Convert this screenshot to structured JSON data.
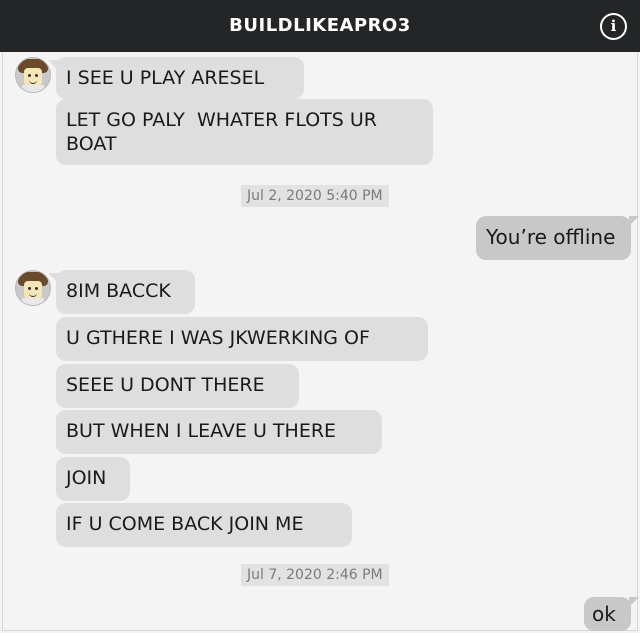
{
  "header": {
    "title": "BUILDLIKEAPRO3",
    "info_icon": "info-icon"
  },
  "messages_group_1": [
    "I SEE U PLAY ARESEL",
    "LET GO PALY  WHATER FLOTS UR BOAT"
  ],
  "timestamp_1": "Jul 2, 2020 5:40 PM",
  "outgoing_1": "You’re offline",
  "messages_group_2": [
    "8IM BACCK",
    "U GTHERE I WAS JKWERKING OF",
    "SEEE U DONT THERE",
    "BUT WHEN I LEAVE U THERE",
    "JOIN",
    "IF U COME BACK JOIN ME"
  ],
  "timestamp_2": "Jul 7, 2020 2:46 PM",
  "outgoing_2": "ok",
  "colors": {
    "header_bg": "#232527",
    "incoming_bubble": "#dedede",
    "outgoing_bubble": "#c8c8c8",
    "chat_bg": "#f4f4f4"
  }
}
